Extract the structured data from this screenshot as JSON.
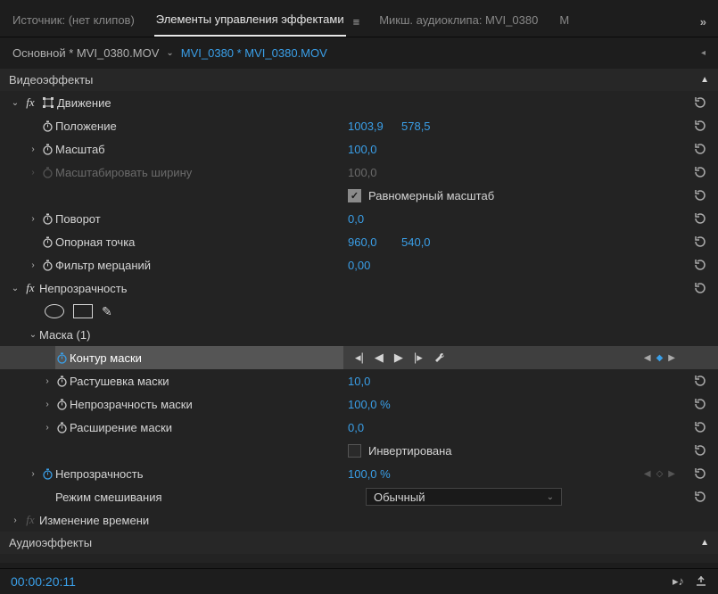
{
  "tabs": {
    "source": "Источник: (нет клипов)",
    "effect_controls": "Элементы управления эффектами",
    "audio_mixer": "Микш. аудиоклипа: MVI_0380",
    "extra": "М"
  },
  "breadcrumb": {
    "master": "Основной * MVI_0380.MOV",
    "clip": "MVI_0380 * MVI_0380.MOV"
  },
  "sections": {
    "video": "Видеоэффекты",
    "audio": "Аудиоэффекты"
  },
  "effects": {
    "motion": {
      "name": "Движение",
      "position": {
        "label": "Положение",
        "x": "1003,9",
        "y": "578,5"
      },
      "scale": {
        "label": "Масштаб",
        "value": "100,0"
      },
      "scale_width": {
        "label": "Масштабировать ширину",
        "value": "100,0"
      },
      "uniform": {
        "label": "Равномерный масштаб"
      },
      "rotation": {
        "label": "Поворот",
        "value": "0,0"
      },
      "anchor": {
        "label": "Опорная точка",
        "x": "960,0",
        "y": "540,0"
      },
      "flicker": {
        "label": "Фильтр мерцаний",
        "value": "0,00"
      }
    },
    "opacity": {
      "name": "Непрозрачность",
      "mask": {
        "name": "Маска (1)",
        "path": "Контур маски",
        "feather": {
          "label": "Растушевка маски",
          "value": "10,0"
        },
        "opacity": {
          "label": "Непрозрачность маски",
          "value": "100,0 %"
        },
        "expansion": {
          "label": "Расширение маски",
          "value": "0,0"
        },
        "inverted": "Инвертирована"
      },
      "value": {
        "label": "Непрозрачность",
        "value": "100,0 %"
      },
      "blend": {
        "label": "Режим смешивания",
        "value": "Обычный"
      }
    },
    "time_remap": "Изменение времени"
  },
  "timecode": "00:00:20:11"
}
